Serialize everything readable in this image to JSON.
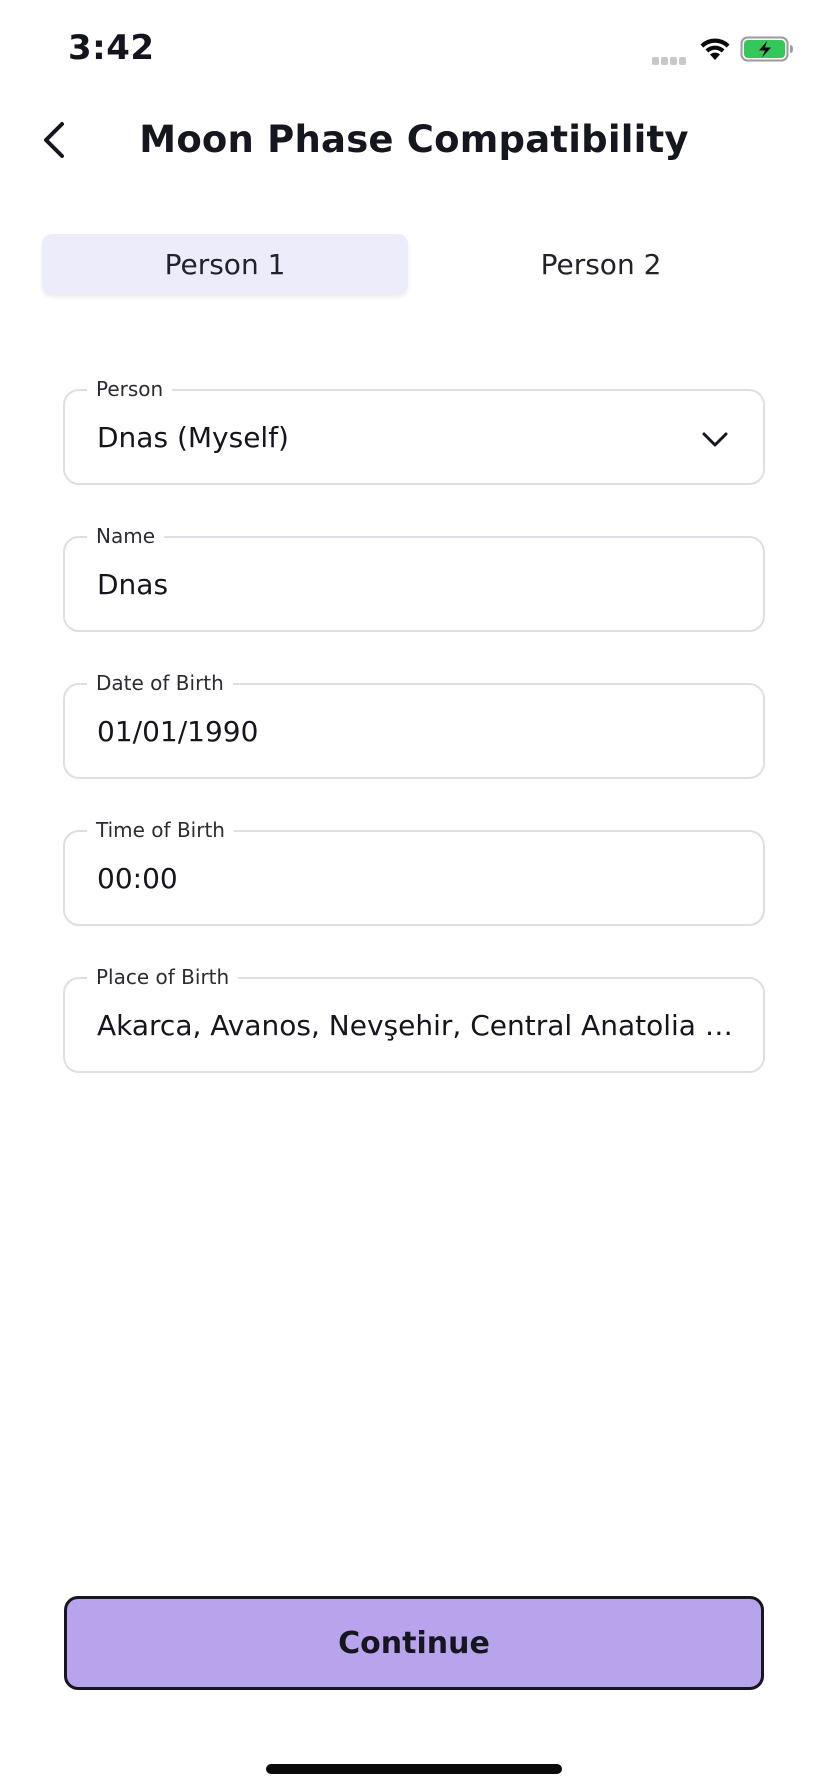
{
  "status_bar": {
    "time": "3:42",
    "icons": [
      "cellular-signal-icon",
      "wifi-icon",
      "battery-charging-icon"
    ],
    "battery_color": "#34c759"
  },
  "header": {
    "title": "Moon Phase Compatibility",
    "back_icon": "chevron-left-icon"
  },
  "tabs": [
    {
      "label": "Person 1",
      "active": true
    },
    {
      "label": "Person 2",
      "active": false
    }
  ],
  "form": {
    "person": {
      "label": "Person",
      "value": "Dnas (Myself)",
      "icon": "chevron-down-icon"
    },
    "name": {
      "label": "Name",
      "value": "Dnas"
    },
    "date_of_birth": {
      "label": "Date of Birth",
      "value": "01/01/1990"
    },
    "time_of_birth": {
      "label": "Time of Birth",
      "value": "00:00"
    },
    "place_of_birth": {
      "label": "Place of Birth",
      "value": "Akarca, Avanos, Nevşehir, Central Anatolia Region, Türkiye"
    }
  },
  "continue_label": "Continue",
  "colors": {
    "accent": "#b8a4ec",
    "active_tab": "#ececfb",
    "border": "#dedee4",
    "text": "#16161e"
  }
}
